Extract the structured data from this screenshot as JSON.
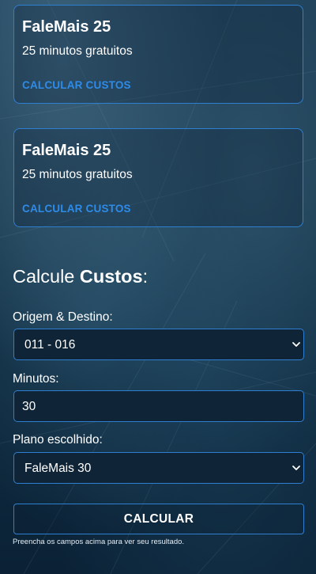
{
  "plans": [
    {
      "title": "FaleMais 25",
      "subtitle": "25 minutos gratuitos",
      "link_label": "CALCULAR CUSTOS"
    },
    {
      "title": "FaleMais 25",
      "subtitle": "25 minutos gratuitos",
      "link_label": "CALCULAR CUSTOS"
    }
  ],
  "calculator": {
    "heading_prefix": "Calcule ",
    "heading_bold": "Custos",
    "heading_suffix": ":",
    "origin_label": "Origem & Destino:",
    "origin_value": "011 - 016",
    "minutes_label": "Minutos:",
    "minutes_value": "30",
    "plan_label": "Plano escolhido:",
    "plan_value": "FaleMais 30",
    "button_label": "CALCULAR",
    "hint": "Preencha os campos acima para ver seu resultado."
  },
  "colors": {
    "accent_border": "#2f7fd1",
    "link": "#2e8be8",
    "background": "#163549"
  },
  "icons": {
    "select_arrow": "chevron-down-icon"
  }
}
